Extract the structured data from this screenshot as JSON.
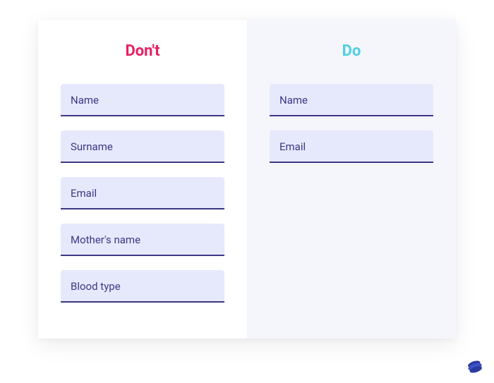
{
  "headings": {
    "dont": "Don't",
    "do": "Do"
  },
  "dont_fields": [
    "Name",
    "Surname",
    "Email",
    "Mother's name",
    "Blood type"
  ],
  "do_fields": [
    "Name",
    "Email"
  ],
  "colors": {
    "dont": "#e91e63",
    "do": "#4dd0e1",
    "field_bg": "#e6e9fb",
    "field_border": "#3d3787",
    "field_text": "#3d3787",
    "right_panel_bg": "#f5f6fb"
  }
}
